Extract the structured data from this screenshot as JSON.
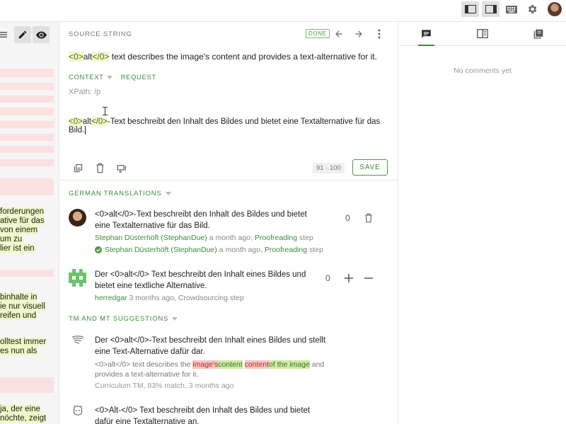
{
  "topbar": {
    "icons": [
      "sidebar-left-icon",
      "sidebar-right-icon",
      "keyboard-icon",
      "gear-icon",
      "user-avatar"
    ]
  },
  "left_strip": {
    "fragments": [
      "forderungen",
      "ative für das",
      "von einem",
      "um zu",
      "lier ist ein",
      "binhalte in",
      "ie nur visuell",
      "reifen und",
      "olltest immer",
      "es nun als",
      "ja, der eine",
      "nöchte, zeigt"
    ]
  },
  "source": {
    "header": "SOURCE STRING",
    "status": "DONE",
    "tag_open": "<0>",
    "tag_word": "alt",
    "tag_close": "</0>",
    "text_rest": " text describes the image's content and provides a text-alternative for it.",
    "context_label": "CONTEXT",
    "request_label": "REQUEST",
    "xpath": "XPath: /p"
  },
  "editor": {
    "tag_open": "<0>",
    "tag_word": "alt",
    "tag_close": "</0>",
    "text_rest": "-Text beschreibt den Inhalt des Bildes und bietet eine Textalternative für das Bild.",
    "counter": "91 · 100",
    "save_label": "SAVE"
  },
  "translations": {
    "header": "GERMAN TRANSLATIONS",
    "items": [
      {
        "text": "<0>alt</0>-Text beschreibt den Inhalt des Bildes und bietet eine Textalternative für das Bild.",
        "author": "Stephan Düsterhöft (StephanDue)",
        "time": " a month ago, ",
        "step": "Proofreading",
        "step_suffix": " step",
        "approver": "Stephan Düsterhöft (StephanDue)",
        "approve_time": " a month ago, ",
        "approve_step": "Proofreading",
        "approve_suffix": " step",
        "votes": "0"
      },
      {
        "text": "Der <0>alt</0> Text beschreibt den Inhalt eines Bildes und bietet eine textliche Alternative.",
        "author": "herredgar",
        "time": " 3 months ago, Crowdsourcing step",
        "votes": "0"
      }
    ]
  },
  "tm": {
    "header": "TM AND MT SUGGESTIONS",
    "items": [
      {
        "text": "Der <0>alt</0>-Text beschreibt den Inhalt eines Bildes und stellt eine Text-Alternative dafür dar.",
        "diff_prefix": "<0>alt</0> text describes the ",
        "diff_del1": "image's",
        "diff_ins1": "content",
        "diff_space": " ",
        "diff_del2": "content",
        "diff_ins2": "of the image",
        "diff_suffix": " and provides a text-alternative for it.",
        "source": "Curriculum TM, 83% match, 3 months ago"
      },
      {
        "text": "<0>Alt-</0> Text beschreibt den Inhalt des Bildes und bietet dafür eine Textalternative an."
      }
    ]
  },
  "right_panel": {
    "tabs": [
      "comments-icon",
      "glossary-icon",
      "history-icon"
    ],
    "empty_text": "No comments yet"
  },
  "colors": {
    "accent_green": "#3c8c3a",
    "tag_highlight": "#f2f6cf",
    "diff_delete": "#f6c5c2",
    "diff_insert": "#cfe9a8",
    "pink_placeholder": "#fbe1df"
  }
}
